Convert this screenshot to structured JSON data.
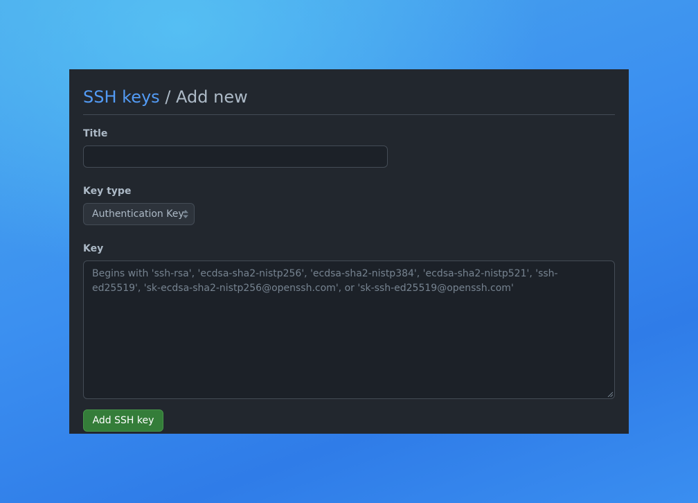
{
  "breadcrumb": {
    "parent_label": "SSH keys",
    "separator": "/",
    "current_label": "Add new"
  },
  "form": {
    "title_label": "Title",
    "title_value": "",
    "key_type_label": "Key type",
    "key_type_selected": "Authentication Key",
    "key_label": "Key",
    "key_placeholder": "Begins with 'ssh-rsa', 'ecdsa-sha2-nistp256', 'ecdsa-sha2-nistp384', 'ecdsa-sha2-nistp521', 'ssh-ed25519', 'sk-ecdsa-sha2-nistp256@openssh.com', or 'sk-ssh-ed25519@openssh.com'",
    "submit_label": "Add SSH key"
  },
  "colors": {
    "panel_bg": "#22272e",
    "link": "#539bf5",
    "text": "#adbac7",
    "muted": "#768390",
    "border": "#444c56",
    "input_bg": "#1c2128",
    "button_bg": "#347d39"
  },
  "icons": {
    "select_arrow": "select-arrows-icon",
    "resize": "resize-grip-icon"
  }
}
